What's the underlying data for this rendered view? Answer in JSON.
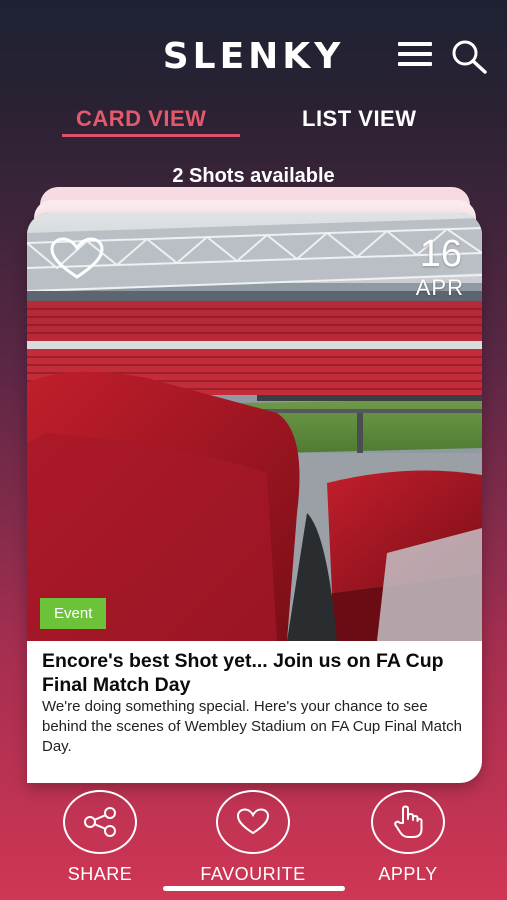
{
  "header": {
    "logo": "SLENKY",
    "menu_icon": "hamburger-menu-icon",
    "search_icon": "search-icon"
  },
  "tabs": [
    {
      "label": "CARD VIEW",
      "active": true
    },
    {
      "label": "LIST VIEW",
      "active": false
    }
  ],
  "shots_available": "2 Shots available",
  "card": {
    "date_day": "16",
    "date_month": "APR",
    "badge": "Event",
    "title": "Encore's best Shot yet... Join us on FA Cup Final Match Day",
    "description": "We're doing something special. Here's your chance to see behind the scenes of Wembley Stadium on FA Cup Final Match Day."
  },
  "actions": [
    {
      "label": "SHARE",
      "icon": "share-icon"
    },
    {
      "label": "FAVOURITE",
      "icon": "heart-icon"
    },
    {
      "label": "APPLY",
      "icon": "hand-pointer-icon"
    }
  ],
  "colors": {
    "active_tab": "#e35a6c",
    "badge": "#6cc33a",
    "accent_bottom": "#cf3654"
  }
}
